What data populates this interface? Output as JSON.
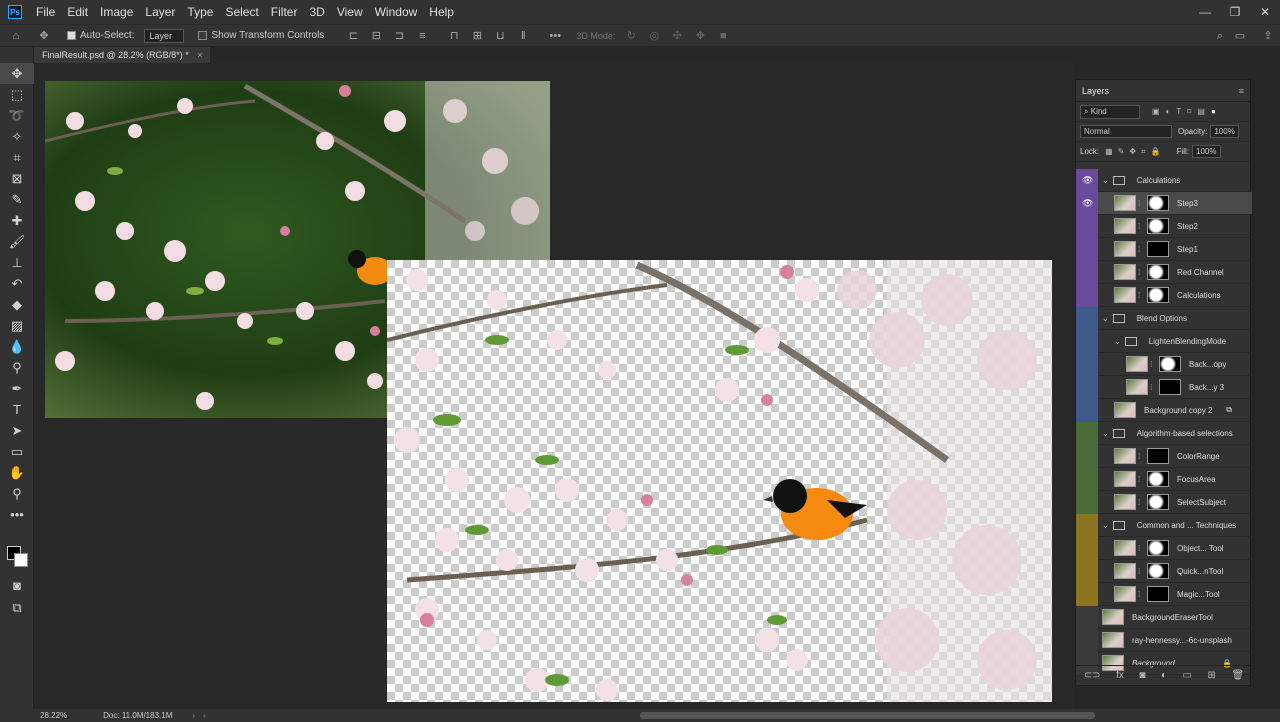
{
  "menu": {
    "logo": "Ps",
    "items": [
      "File",
      "Edit",
      "Image",
      "Layer",
      "Type",
      "Select",
      "Filter",
      "3D",
      "View",
      "Window",
      "Help"
    ]
  },
  "window_controls": {
    "minimize": "—",
    "maximize": "❐",
    "close": "✕"
  },
  "options": {
    "auto_select_label": "Auto-Select:",
    "auto_select_value": "Layer",
    "show_transform_label": "Show Transform Controls",
    "three_d_mode": "3D Mode:"
  },
  "document": {
    "tab_title": "FinalResult.psd @ 28.2% (RGB/8*) *",
    "tab_close": "×"
  },
  "status": {
    "zoom": "28.22%",
    "doc_size": "Doc: 11.0M/183.1M"
  },
  "layers_panel": {
    "title": "Layers",
    "kind_filter": "Kind",
    "blend_mode": "Normal",
    "opacity_label": "Opacity:",
    "opacity_value": "100%",
    "lock_label": "Lock:",
    "fill_label": "Fill:",
    "fill_value": "100%",
    "layers": [
      {
        "name": "Calculations",
        "type": "group",
        "indent": 0,
        "color": "#6a4a9a",
        "visible": true
      },
      {
        "name": "Step3",
        "type": "layer",
        "indent": 1,
        "color": "#6a4a9a",
        "visible": true,
        "active": true
      },
      {
        "name": "Step2",
        "type": "layer",
        "indent": 1,
        "color": "#6a4a9a",
        "visible": false
      },
      {
        "name": "Step1",
        "type": "layer",
        "indent": 1,
        "color": "#6a4a9a",
        "visible": false
      },
      {
        "name": "Red Channel",
        "type": "layer",
        "indent": 1,
        "color": "#6a4a9a",
        "visible": false
      },
      {
        "name": "Calculations",
        "type": "layer",
        "indent": 1,
        "color": "#6a4a9a",
        "visible": false
      },
      {
        "name": "Blend Options",
        "type": "group",
        "indent": 0,
        "color": "#3e5a8a",
        "visible": false
      },
      {
        "name": "LightenBlendingMode",
        "type": "group",
        "indent": 1,
        "color": "#3e5a8a",
        "visible": false
      },
      {
        "name": "Back...opy",
        "type": "layer",
        "indent": 2,
        "color": "#3e5a8a",
        "visible": false
      },
      {
        "name": "Back...y 3",
        "type": "layer",
        "indent": 2,
        "color": "#3e5a8a",
        "visible": false
      },
      {
        "name": "Background copy 2",
        "type": "layer",
        "indent": 1,
        "color": "#3e5a8a",
        "visible": false
      },
      {
        "name": "Algorithm-based selections",
        "type": "group",
        "indent": 0,
        "color": "#4a6a3a",
        "visible": false
      },
      {
        "name": "ColorRange",
        "type": "layer",
        "indent": 1,
        "color": "#4a6a3a",
        "visible": false
      },
      {
        "name": "FocusArea",
        "type": "layer",
        "indent": 1,
        "color": "#4a6a3a",
        "visible": false
      },
      {
        "name": "SelectSubject",
        "type": "layer",
        "indent": 1,
        "color": "#4a6a3a",
        "visible": false
      },
      {
        "name": "Common and ... Techniques",
        "type": "group",
        "indent": 0,
        "color": "#8a7420",
        "visible": false
      },
      {
        "name": "Object... Tool",
        "type": "layer",
        "indent": 1,
        "color": "#8a7420",
        "visible": false
      },
      {
        "name": "Quick...nTool",
        "type": "layer",
        "indent": 1,
        "color": "#8a7420",
        "visible": false
      },
      {
        "name": "Magic...Tool",
        "type": "layer",
        "indent": 1,
        "color": "#8a7420",
        "visible": false
      },
      {
        "name": "BackgroundEraserTool",
        "type": "layer",
        "indent": 0,
        "color": "#3a3a3a",
        "visible": false
      },
      {
        "name": "ray-hennessy...-6c-unsplash",
        "type": "layer",
        "indent": 0,
        "color": "#3a3a3a",
        "visible": false
      },
      {
        "name": "Background",
        "type": "layer",
        "indent": 0,
        "color": "#3a3a3a",
        "visible": false,
        "locked": true
      }
    ],
    "footer_icons": [
      "link-icon",
      "fx-icon",
      "mask-icon",
      "adjustment-icon",
      "folder-icon",
      "new-layer-icon",
      "trash-icon"
    ]
  },
  "tools": [
    "move-tool",
    "marquee-tool",
    "lasso-tool",
    "magic-wand-tool",
    "crop-tool",
    "frame-tool",
    "eyedropper-tool",
    "healing-tool",
    "brush-tool",
    "stamp-tool",
    "history-brush-tool",
    "eraser-tool",
    "gradient-tool",
    "blur-tool",
    "dodge-tool",
    "pen-tool",
    "type-tool",
    "path-selection-tool",
    "rectangle-tool",
    "hand-tool",
    "zoom-tool",
    "more-tools"
  ]
}
